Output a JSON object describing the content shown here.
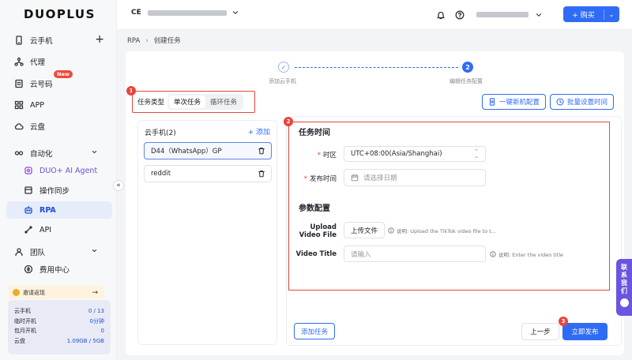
{
  "brand": "DUOPLUS",
  "sidebar": {
    "items": [
      {
        "label": "云手机",
        "icon": "phone-icon"
      },
      {
        "label": "代理",
        "icon": "proxy-icon"
      },
      {
        "label": "云号码",
        "icon": "number-icon",
        "badge": "New"
      },
      {
        "label": "APP",
        "icon": "app-grid-icon"
      },
      {
        "label": "云盘",
        "icon": "cloud-icon"
      },
      {
        "label": "自动化",
        "icon": "automation-icon"
      },
      {
        "label": "DUO+ AI Agent",
        "icon": "ai-agent-icon"
      },
      {
        "label": "操作同步",
        "icon": "sync-icon"
      },
      {
        "label": "RPA",
        "icon": "rpa-icon"
      },
      {
        "label": "API",
        "icon": "api-icon"
      },
      {
        "label": "团队",
        "icon": "team-icon"
      },
      {
        "label": "费用中心",
        "icon": "billing-icon"
      }
    ],
    "invite_label": "邀请返现",
    "usage": [
      {
        "label": "云手机",
        "value": "0 / 13"
      },
      {
        "label": "临时开机",
        "value": "0分钟"
      },
      {
        "label": "包月开机",
        "value": "0"
      },
      {
        "label": "云盘",
        "value": "1.09GB / 5GB"
      }
    ]
  },
  "header": {
    "account_initials": "CE",
    "buy_label": "购买"
  },
  "breadcrumb": {
    "root": "RPA",
    "current": "创建任务"
  },
  "steps": [
    {
      "label": "添加云手机",
      "mark": "✓"
    },
    {
      "label": "编辑任务配置",
      "mark": "2"
    }
  ],
  "task_type": {
    "label": "任务类型",
    "options": [
      "单次任务",
      "循环任务"
    ],
    "selected": "单次任务"
  },
  "markers": [
    "1",
    "2",
    "3"
  ],
  "top_buttons": {
    "config": "一键新机配置",
    "batch_time": "批量设置时间"
  },
  "phones": {
    "title": "云手机(2)",
    "add_label": "添加",
    "items": [
      "D44（WhatsApp）GP",
      "reddit"
    ]
  },
  "task_time": {
    "section_title": "任务时间",
    "timezone_label": "时区",
    "timezone_value": "UTC+08:00(Asia/Shanghai)",
    "publish_label": "发布时间",
    "publish_placeholder": "请选择日期"
  },
  "params": {
    "section_title": "参数配置",
    "upload_label": "Upload Video File",
    "upload_button": "上传文件",
    "upload_hint": "说明: Upload the TikTok video file to t...",
    "title_label": "Video Title",
    "title_placeholder": "请输入",
    "title_hint": "说明: Enter the video title"
  },
  "footer": {
    "add_task": "添加任务",
    "prev": "上一步",
    "publish": "立即发布"
  },
  "contact": "联系我们",
  "colors": {
    "primary": "#2f6cf6",
    "annotation": "#e8463c",
    "contact": "#6a54e0"
  }
}
